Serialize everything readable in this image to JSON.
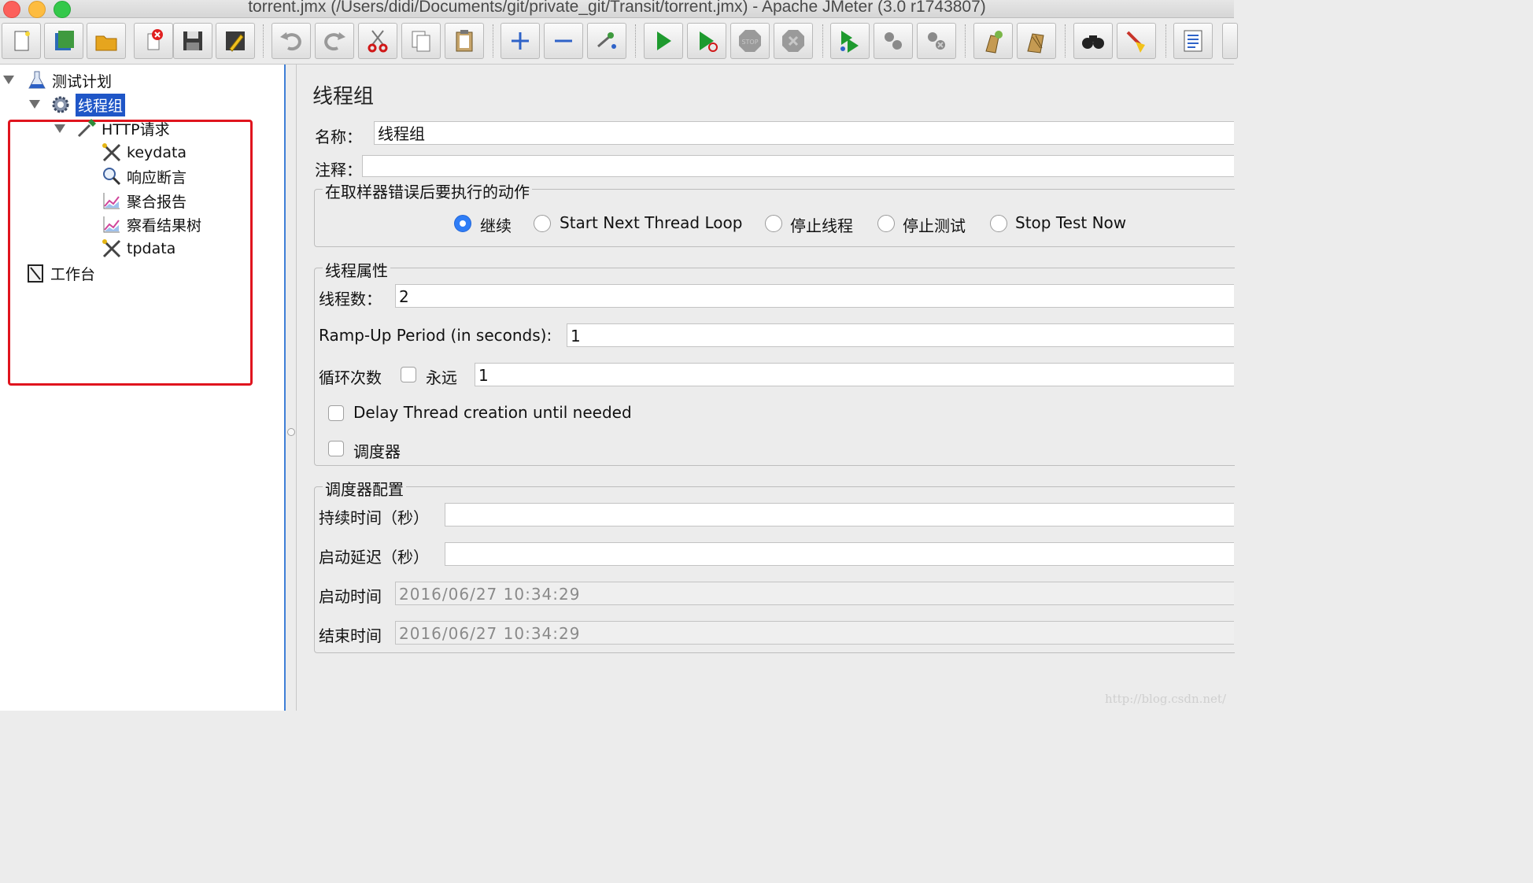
{
  "window": {
    "title": "torrent.jmx (/Users/didi/Documents/git/private_git/Transit/torrent.jmx) - Apache JMeter (3.0 r1743807)"
  },
  "toolbar": {
    "buttons": [
      "new-icon",
      "templates-icon",
      "open-icon",
      "close-icon",
      "save-icon",
      "save-as-icon",
      "undo-icon",
      "redo-icon",
      "cut-icon",
      "copy-icon",
      "paste-icon",
      "expand-icon",
      "collapse-icon",
      "toggle-icon",
      "start-icon",
      "start-no-pause-icon",
      "stop-icon",
      "shutdown-icon",
      "remote-start-icon",
      "remote-start-all-icon",
      "remote-stop-icon",
      "clear-icon",
      "clear-all-icon",
      "search-icon",
      "reset-search-icon",
      "function-helper-icon"
    ]
  },
  "tree": {
    "items": [
      {
        "label": "测试计划",
        "icon": "flask-icon"
      },
      {
        "label": "线程组",
        "icon": "gear-icon",
        "selected": true
      },
      {
        "label": "HTTP请求",
        "icon": "pipette-icon"
      },
      {
        "label": "keydata",
        "icon": "tools-icon"
      },
      {
        "label": "响应断言",
        "icon": "magnifier-icon"
      },
      {
        "label": "聚合报告",
        "icon": "graph-icon"
      },
      {
        "label": "察看结果树",
        "icon": "graph-icon"
      },
      {
        "label": "tpdata",
        "icon": "tools-icon"
      },
      {
        "label": "工作台",
        "icon": "workbench-icon"
      }
    ]
  },
  "form": {
    "heading": "线程组",
    "name_label": "名称：",
    "name_value": "线程组",
    "comment_label": "注释：",
    "comment_value": "",
    "error_action": {
      "title": "在取样器错误后要执行的动作",
      "options": [
        "继续",
        "Start Next Thread Loop",
        "停止线程",
        "停止测试",
        "Stop Test Now"
      ],
      "selected": "继续"
    },
    "thread_props": {
      "title": "线程属性",
      "threads_label": "线程数：",
      "threads_value": "2",
      "rampup_label": "Ramp-Up Period (in seconds):",
      "rampup_value": "1",
      "loop_label": "循环次数",
      "forever_label": "永远",
      "forever_checked": false,
      "loop_value": "1",
      "delay_label": "Delay Thread creation until needed",
      "delay_checked": false,
      "scheduler_label": "调度器",
      "scheduler_checked": false
    },
    "scheduler_config": {
      "title": "调度器配置",
      "duration_label": "持续时间（秒）",
      "duration_value": "",
      "delay_label": "启动延迟（秒）",
      "delay_value": "",
      "start_label": "启动时间",
      "start_value": "2016/06/27 10:34:29",
      "end_label": "结束时间",
      "end_value": "2016/06/27 10:34:29"
    }
  },
  "watermark": "http://blog.csdn.net/",
  "colors": {
    "selection": "#1f56c7",
    "highlight_box": "#e0141e",
    "radio_checked": "#2f7df6"
  }
}
